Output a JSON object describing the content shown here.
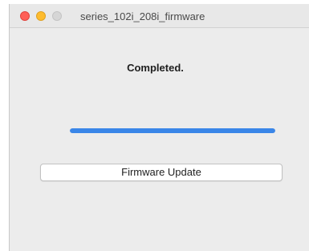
{
  "window": {
    "title": "series_102i_208i_firmware"
  },
  "status": {
    "text": "Completed."
  },
  "progress": {
    "value_percent": 100,
    "color": "#3a86e8"
  },
  "actions": {
    "update_label": "Firmware Update"
  },
  "traffic_lights": {
    "close_color": "#fe5f57",
    "minimize_color": "#febc2e",
    "zoom_color": "#d6d6d6"
  }
}
